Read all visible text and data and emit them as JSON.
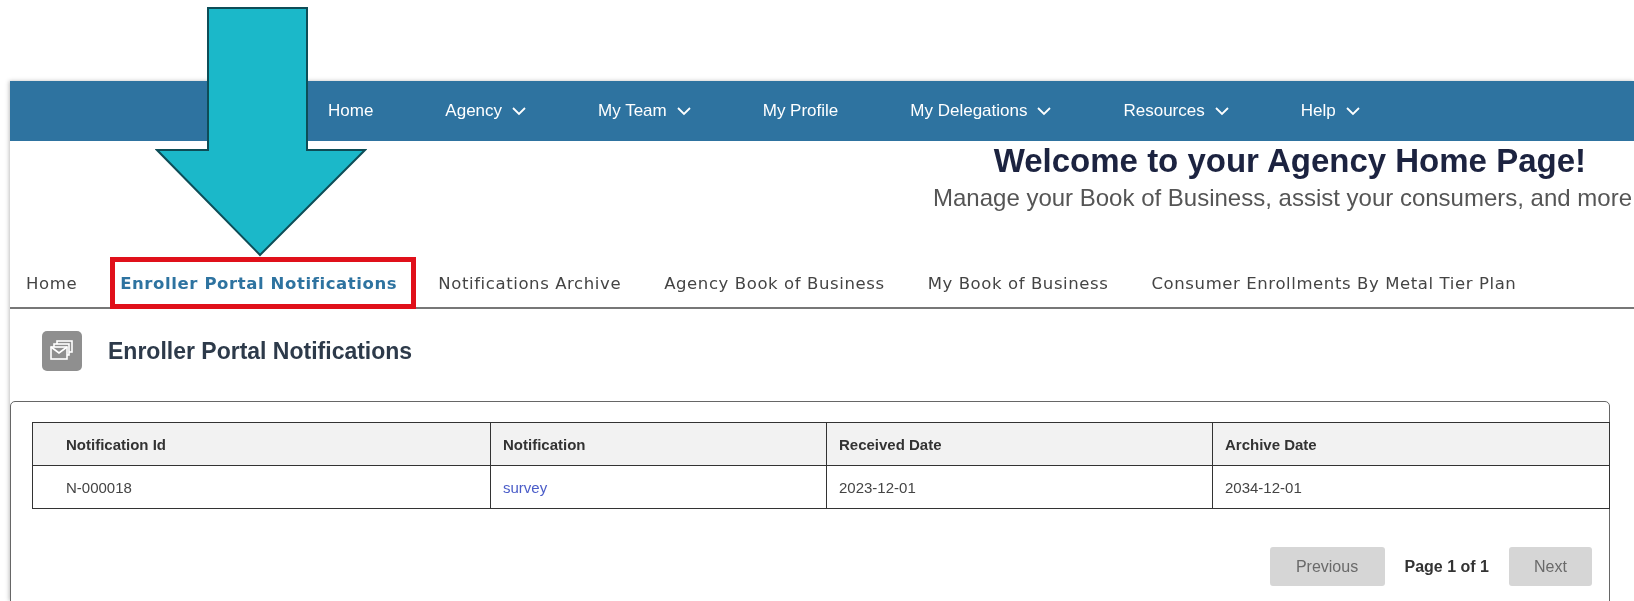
{
  "nav": {
    "items": [
      {
        "label": "Home",
        "dropdown": false
      },
      {
        "label": "Agency",
        "dropdown": true
      },
      {
        "label": "My Team",
        "dropdown": true
      },
      {
        "label": "My Profile",
        "dropdown": false
      },
      {
        "label": "My Delegations",
        "dropdown": true
      },
      {
        "label": "Resources",
        "dropdown": true
      },
      {
        "label": "Help",
        "dropdown": true
      }
    ]
  },
  "header": {
    "title": "Welcome to your Agency Home Page!",
    "subtitle": "Manage your Book of Business, assist your consumers, and more"
  },
  "tabs": [
    {
      "label": "Home",
      "selected": false,
      "highlighted": false
    },
    {
      "label": "Enroller Portal Notifications",
      "selected": true,
      "highlighted": true
    },
    {
      "label": "Notifications Archive",
      "selected": false,
      "highlighted": false
    },
    {
      "label": "Agency Book of Business",
      "selected": false,
      "highlighted": false
    },
    {
      "label": "My Book of Business",
      "selected": false,
      "highlighted": false
    },
    {
      "label": "Consumer Enrollments By Metal Tier Plan",
      "selected": false,
      "highlighted": false
    }
  ],
  "page_heading": "Enroller Portal Notifications",
  "table": {
    "columns": [
      "Notification Id",
      "Notification",
      "Received Date",
      "Archive Date"
    ],
    "rows": [
      [
        {
          "text": "N-000018",
          "kind": "text"
        },
        {
          "text": "survey",
          "kind": "link"
        },
        {
          "text": "2023-12-01",
          "kind": "text"
        },
        {
          "text": "2034-12-01",
          "kind": "text"
        }
      ]
    ]
  },
  "pagination": {
    "previous": {
      "label": "Previous",
      "disabled": true
    },
    "page_info": "Page 1 of 1",
    "next": {
      "label": "Next",
      "disabled": true
    }
  }
}
